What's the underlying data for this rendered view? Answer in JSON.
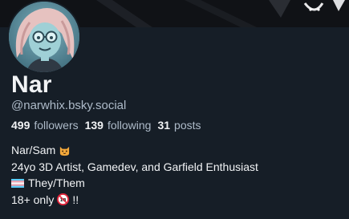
{
  "profile": {
    "display_name": "Nar",
    "handle": "@narwhix.bsky.social",
    "stats": {
      "followers_count": "499",
      "followers_label": "followers",
      "following_count": "139",
      "following_label": "following",
      "posts_count": "31",
      "posts_label": "posts"
    },
    "bio": {
      "line1_text": "Nar/Sam",
      "line1_emoji": "cat-emoji",
      "line2_text": "24yo 3D Artist, Gamedev, and Garfield Enthusiast",
      "line3_emoji": "transgender-flag-emoji",
      "line3_text": "They/Them",
      "line4_text": "18+ only",
      "line4_emoji": "no-one-under-eighteen-emoji",
      "line4_suffix": "!!"
    }
  },
  "colors": {
    "background": "#161e27",
    "text_primary": "#f1f3f5",
    "text_secondary": "#aebbc9"
  }
}
